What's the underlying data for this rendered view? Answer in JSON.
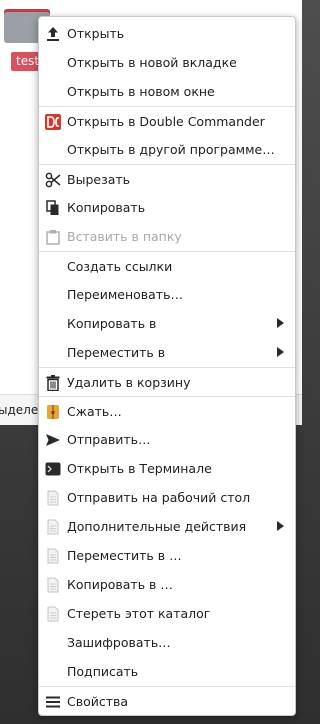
{
  "background": {
    "file_label": "test",
    "status_text": "ыделе"
  },
  "menu": {
    "items": [
      {
        "label": "Открыть",
        "icon": "upload-arrow-icon"
      },
      {
        "label": "Открыть в новой вкладке",
        "icon": ""
      },
      {
        "label": "Открыть в новом окне",
        "icon": ""
      },
      {
        "label": "Открыть в Double Commander",
        "icon": "double-commander-icon"
      },
      {
        "label": "Открыть в другой программе…",
        "icon": ""
      },
      {
        "label": "Вырезать",
        "icon": "scissors-icon"
      },
      {
        "label": "Копировать",
        "icon": "copy-icon"
      },
      {
        "label": "Вставить в папку",
        "icon": "paste-icon"
      },
      {
        "label": "Создать ссылки",
        "icon": ""
      },
      {
        "label": "Переименовать…",
        "icon": ""
      },
      {
        "label": "Копировать в",
        "icon": ""
      },
      {
        "label": "Переместить в",
        "icon": ""
      },
      {
        "label": "Удалить в корзину",
        "icon": "trash-icon"
      },
      {
        "label": "Сжать…",
        "icon": "archive-icon"
      },
      {
        "label": "Отправить…",
        "icon": "send-icon"
      },
      {
        "label": "Открыть в Терминале",
        "icon": "terminal-icon"
      },
      {
        "label": "Отправить на рабочий стол",
        "icon": "document-icon"
      },
      {
        "label": "Дополнительные действия",
        "icon": "document-icon"
      },
      {
        "label": "Переместить в …",
        "icon": "document-icon"
      },
      {
        "label": "Копировать в …",
        "icon": "document-icon"
      },
      {
        "label": "Стереть этот каталог",
        "icon": "document-icon"
      },
      {
        "label": "Зашифровать…",
        "icon": ""
      },
      {
        "label": "Подписать",
        "icon": ""
      },
      {
        "label": "Свойства",
        "icon": "properties-icon"
      }
    ]
  },
  "colors": {
    "accent_red": "#d9505e",
    "disabled_text": "#a8a8a8"
  }
}
